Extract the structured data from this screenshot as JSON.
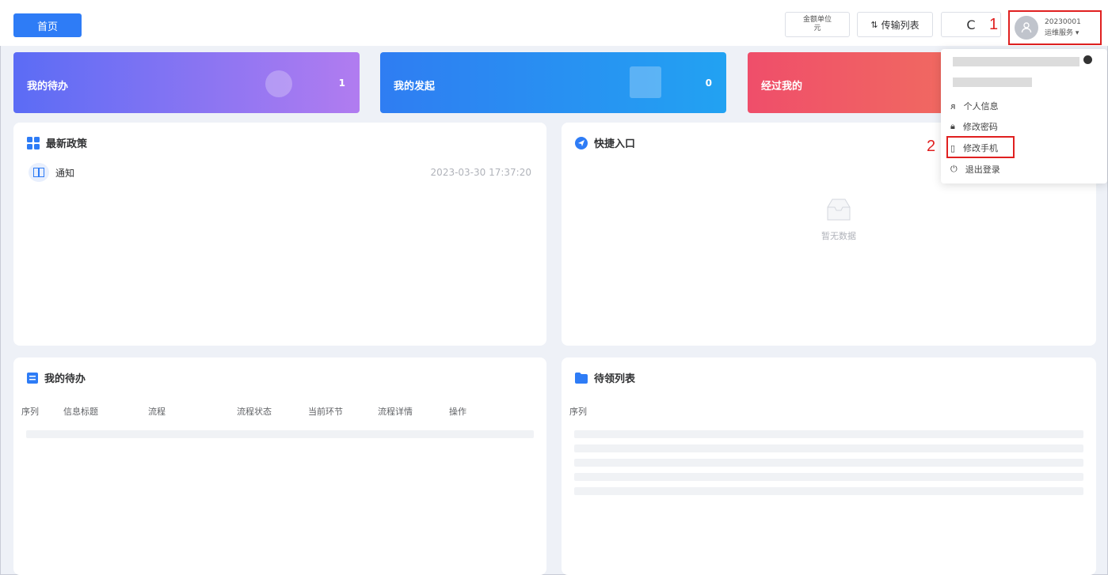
{
  "header": {
    "home_label": "首页",
    "unit_line1": "金额单位",
    "unit_line2": "元",
    "transfer_label": "传输列表",
    "refresh_symbol": "C",
    "user_id": "20230001",
    "user_role": "运维服务"
  },
  "annotations": {
    "marker1": "1",
    "marker2": "2"
  },
  "stats": {
    "todo": {
      "label": "我的待办",
      "count": "1"
    },
    "started": {
      "label": "我的发起",
      "count": "0"
    },
    "passed": {
      "label": "经过我的"
    }
  },
  "policy": {
    "title": "最新政策",
    "item_label": "通知",
    "item_time": "2023-03-30 17:37:20"
  },
  "quick": {
    "title": "快捷入口",
    "empty_text": "暂无数据"
  },
  "my_todo": {
    "title": "我的待办",
    "columns": [
      "序列",
      "信息标题",
      "流程",
      "流程状态",
      "当前环节",
      "流程详情",
      "操作"
    ]
  },
  "pending": {
    "title": "待领列表",
    "columns": [
      "序列"
    ]
  },
  "user_menu": {
    "items": [
      "个人信息",
      "修改密码",
      "修改手机",
      "退出登录"
    ]
  },
  "colors": {
    "primary": "#2e7cf6",
    "annotation_red": "#e02020"
  }
}
